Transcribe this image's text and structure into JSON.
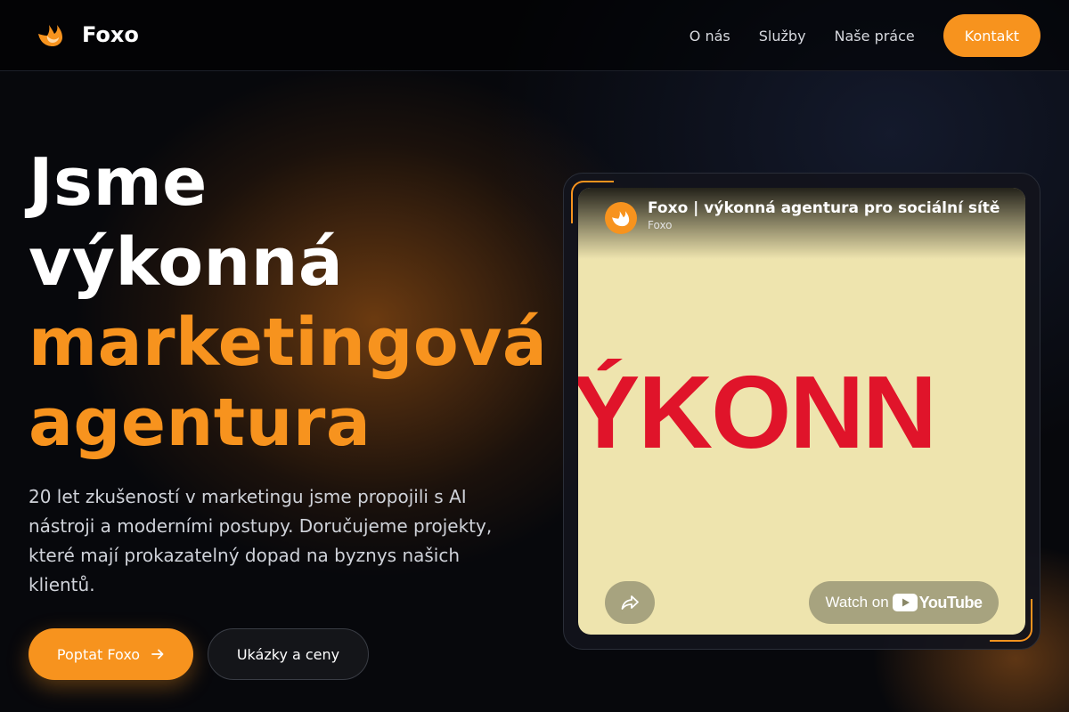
{
  "colors": {
    "accent": "#f7931e",
    "background": "#07080c",
    "video_red": "#e0142a",
    "video_bg": "#eee4ae"
  },
  "nav": {
    "logo_text": "Foxo",
    "logo_icon": "fox-logo-icon",
    "links": [
      "O nás",
      "Služby",
      "Naše práce"
    ],
    "cta": "Kontakt"
  },
  "hero": {
    "title_lines": [
      "Jsme",
      "výkonná",
      "marketingová",
      "agentura"
    ],
    "description": "20 let zkušeností v marketingu jsme propojili s AI nástroji a moderními postupy. Doručujeme projekty, které mají prokazatelný dopad na byznys našich klientů.",
    "primary_button": "Poptat Foxo",
    "primary_button_icon": "arrow-right-icon",
    "secondary_button": "Ukázky a ceny"
  },
  "video": {
    "title": "Foxo | výkonná agentura pro sociální sítě",
    "channel": "Foxo",
    "big_text": "ÝKONN",
    "share_icon": "share-icon",
    "watch_label": "Watch on",
    "platform": "YouTube"
  }
}
